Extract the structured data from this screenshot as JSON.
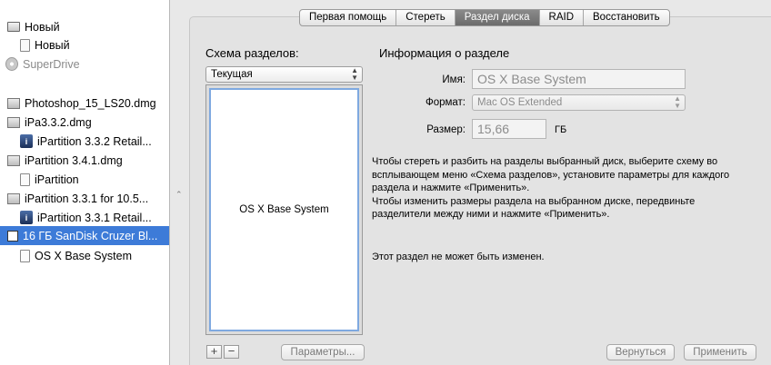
{
  "sidebar": {
    "items": [
      {
        "label": "Новый",
        "icon": "hard-drive-icon"
      },
      {
        "label": "Новый",
        "icon": "volume-icon"
      },
      {
        "label": "SuperDrive",
        "icon": "cd-icon"
      },
      {
        "label": "Photoshop_15_LS20.dmg",
        "icon": "disk-image-icon"
      },
      {
        "label": "iPa3.3.2.dmg",
        "icon": "disk-image-icon"
      },
      {
        "label": "iPartition 3.3.2 Retail...",
        "icon": "app-volume-icon"
      },
      {
        "label": "iPartition 3.4.1.dmg",
        "icon": "disk-image-icon"
      },
      {
        "label": "iPartition",
        "icon": "volume-icon"
      },
      {
        "label": "iPartition 3.3.1 for 10.5...",
        "icon": "disk-image-icon"
      },
      {
        "label": "iPartition 3.3.1 Retail...",
        "icon": "app-volume-icon"
      },
      {
        "label": "16 ГБ SanDisk Cruzer Bl...",
        "icon": "usb-drive-icon"
      },
      {
        "label": "OS X Base System",
        "icon": "volume-icon"
      }
    ],
    "splitter_glyph": "⌃"
  },
  "tabs": [
    "Первая помощь",
    "Стереть",
    "Раздел диска",
    "RAID",
    "Восстановить"
  ],
  "active_tab": "Раздел диска",
  "scheme": {
    "title": "Схема разделов:",
    "select_value": "Текущая",
    "partition_name": "OS X Base System",
    "add_label": "+",
    "remove_label": "−",
    "options_label": "Параметры..."
  },
  "info": {
    "title": "Информация о разделе",
    "name_label": "Имя:",
    "name_value": "OS X Base System",
    "format_label": "Формат:",
    "format_value": "Mac OS Extended",
    "size_label": "Размер:",
    "size_value": "15,66",
    "size_unit": "ГБ",
    "hint": "Чтобы стереть и разбить на разделы выбранный диск, выберите схему во\nвсплывающем меню «Схема разделов», установите параметры для каждого\nраздела и нажмите «Применить».\nЧтобы изменить размеры раздела на выбранном диске, передвиньте\nразделители между ними и нажмите «Применить».",
    "status": "Этот раздел не может быть изменен."
  },
  "actions": {
    "revert_label": "Вернуться",
    "apply_label": "Применить"
  },
  "colors": {
    "selection": "#3d7bd8",
    "partition_border": "#7fa9e0"
  }
}
